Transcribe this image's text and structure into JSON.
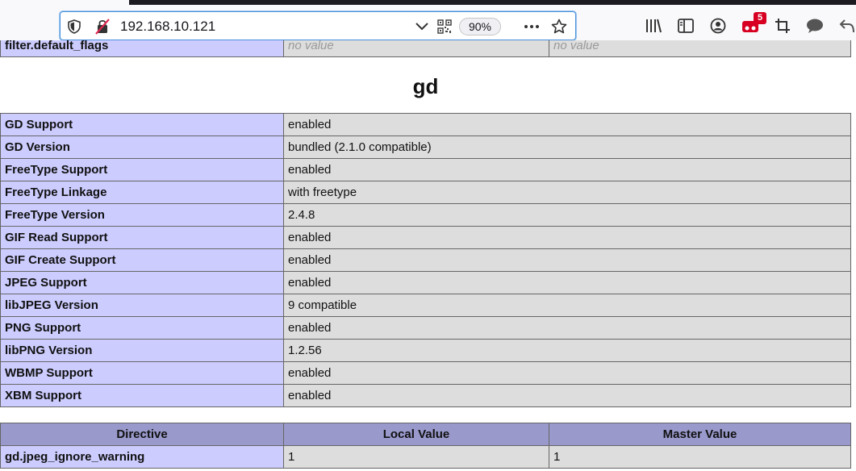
{
  "browser": {
    "url": "192.168.10.121",
    "zoom": "90%",
    "notification_count": "5",
    "icons": [
      "shield-icon",
      "insecure-lock-icon",
      "chevron-down-icon",
      "qr-code-icon",
      "more-icon",
      "star-icon",
      "library-icon",
      "sidebar-icon",
      "account-icon",
      "extension-icon",
      "crop-icon",
      "chat-icon",
      "back-icon"
    ]
  },
  "partial_row": {
    "name": "filter.default_flags",
    "local": "no value",
    "master": "no value"
  },
  "section_title": "gd",
  "info_rows": [
    {
      "name": "GD Support",
      "value": "enabled"
    },
    {
      "name": "GD Version",
      "value": "bundled (2.1.0 compatible)"
    },
    {
      "name": "FreeType Support",
      "value": "enabled"
    },
    {
      "name": "FreeType Linkage",
      "value": "with freetype"
    },
    {
      "name": "FreeType Version",
      "value": "2.4.8"
    },
    {
      "name": "GIF Read Support",
      "value": "enabled"
    },
    {
      "name": "GIF Create Support",
      "value": "enabled"
    },
    {
      "name": "JPEG Support",
      "value": "enabled"
    },
    {
      "name": "libJPEG Version",
      "value": "9 compatible"
    },
    {
      "name": "PNG Support",
      "value": "enabled"
    },
    {
      "name": "libPNG Version",
      "value": "1.2.56"
    },
    {
      "name": "WBMP Support",
      "value": "enabled"
    },
    {
      "name": "XBM Support",
      "value": "enabled"
    }
  ],
  "directives": {
    "headers": [
      "Directive",
      "Local Value",
      "Master Value"
    ],
    "rows": [
      {
        "directive": "gd.jpeg_ignore_warning",
        "local": "1",
        "master": "1"
      }
    ]
  }
}
